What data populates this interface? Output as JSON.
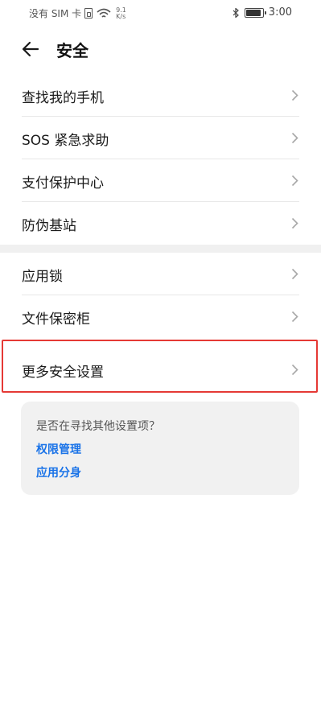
{
  "status_bar": {
    "carrier": "没有 SIM 卡",
    "speed_value": "9.1",
    "speed_unit": "K/s",
    "time": "3:00",
    "battery_level": 0.85,
    "icons": [
      "sim-icon",
      "wifi-icon",
      "bluetooth-icon",
      "battery-icon"
    ]
  },
  "header": {
    "title": "安全",
    "back_icon": "back-arrow-icon"
  },
  "group1": {
    "items": [
      {
        "label": "查找我的手机"
      },
      {
        "label": "SOS 紧急求助"
      },
      {
        "label": "支付保护中心"
      },
      {
        "label": "防伪基站"
      }
    ]
  },
  "group2": {
    "items": [
      {
        "label": "应用锁"
      },
      {
        "label": "文件保密柜"
      },
      {
        "label": "更多安全设置"
      }
    ]
  },
  "highlight_color": "#e53935",
  "suggestion": {
    "title": "是否在寻找其他设置项？",
    "links": [
      {
        "label": "权限管理"
      },
      {
        "label": "应用分身"
      }
    ]
  },
  "colors": {
    "link": "#1a73e8",
    "divider": "#e8e8e8",
    "card_bg": "#f1f1f1"
  }
}
